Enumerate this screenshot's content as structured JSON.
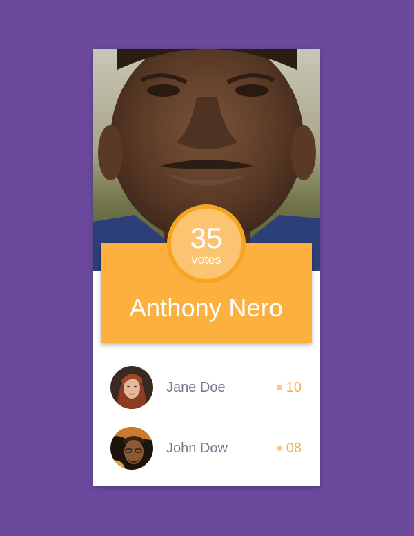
{
  "candidate": {
    "name": "Anthony Nero",
    "votes": "35",
    "votes_label": "votes"
  },
  "voters": [
    {
      "name": "Jane Doe",
      "score": "10"
    },
    {
      "name": "John Dow",
      "score": "08"
    }
  ],
  "colors": {
    "background": "#6b4a9e",
    "accent": "#fbb040",
    "badge": "#fcc370",
    "text_muted": "#7d7490"
  }
}
